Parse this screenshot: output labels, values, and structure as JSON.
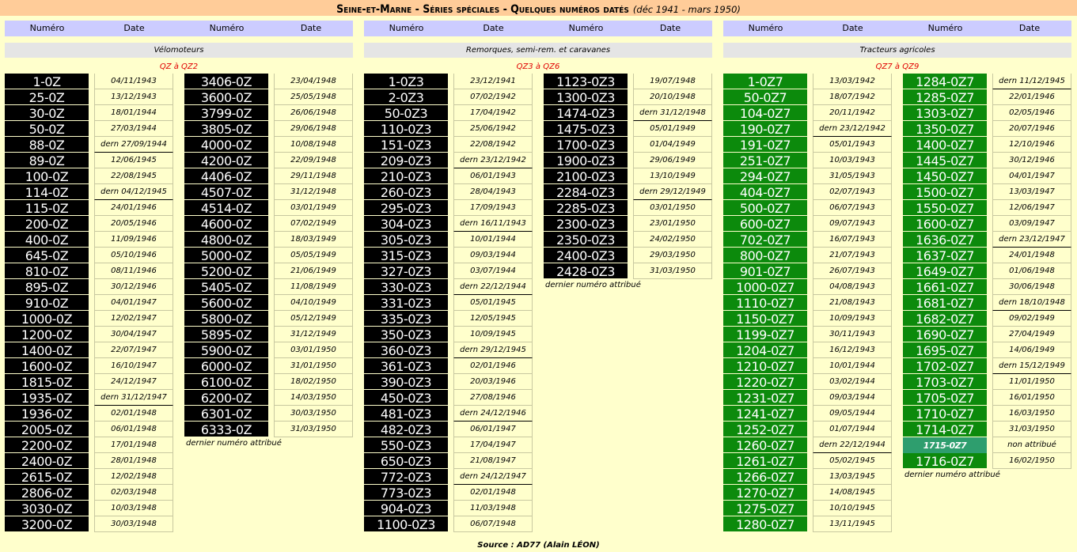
{
  "title": {
    "main": "Seine-et-Marne - Séries spéciales - Quelques numéros datés",
    "sub": "(déc 1941 - mars 1950)"
  },
  "headers": {
    "numero": "Numéro",
    "date": "Date"
  },
  "sections": [
    {
      "category": "Vélomoteurs",
      "range": "QZ à QZ2",
      "last_note": "dernier numéro attribué",
      "color": "#000000",
      "columns": [
        [
          [
            "1-0Z",
            "04/11/1943"
          ],
          [
            "25-0Z",
            "13/12/1943"
          ],
          [
            "30-0Z",
            "18/01/1944"
          ],
          [
            "50-0Z",
            "27/03/1944"
          ],
          [
            "88-0Z",
            "dern 27/09/1944"
          ],
          [
            "89-0Z",
            "12/06/1945"
          ],
          [
            "100-0Z",
            "22/08/1945"
          ],
          [
            "114-0Z",
            "dern 04/12/1945"
          ],
          [
            "115-0Z",
            "24/01/1946"
          ],
          [
            "200-0Z",
            "20/05/1946"
          ],
          [
            "400-0Z",
            "11/09/1946"
          ],
          [
            "645-0Z",
            "05/10/1946"
          ],
          [
            "810-0Z",
            "08/11/1946"
          ],
          [
            "895-0Z",
            "30/12/1946"
          ],
          [
            "910-0Z",
            "04/01/1947"
          ],
          [
            "1000-0Z",
            "12/02/1947"
          ],
          [
            "1200-0Z",
            "30/04/1947"
          ],
          [
            "1400-0Z",
            "22/07/1947"
          ],
          [
            "1600-0Z",
            "16/10/1947"
          ],
          [
            "1815-0Z",
            "24/12/1947"
          ],
          [
            "1935-0Z",
            "dern 31/12/1947"
          ],
          [
            "1936-0Z",
            "02/01/1948"
          ],
          [
            "2005-0Z",
            "06/01/1948"
          ],
          [
            "2200-0Z",
            "17/01/1948"
          ],
          [
            "2400-0Z",
            "28/01/1948"
          ],
          [
            "2615-0Z",
            "12/02/1948"
          ],
          [
            "2806-0Z",
            "02/03/1948"
          ],
          [
            "3030-0Z",
            "10/03/1948"
          ],
          [
            "3200-0Z",
            "30/03/1948"
          ]
        ],
        [
          [
            "3406-0Z",
            "23/04/1948"
          ],
          [
            "3600-0Z",
            "25/05/1948"
          ],
          [
            "3799-0Z",
            "26/06/1948"
          ],
          [
            "3805-0Z",
            "29/06/1948"
          ],
          [
            "4000-0Z",
            "10/08/1948"
          ],
          [
            "4200-0Z",
            "22/09/1948"
          ],
          [
            "4406-0Z",
            "29/11/1948"
          ],
          [
            "4507-0Z",
            "31/12/1948"
          ],
          [
            "4514-0Z",
            "03/01/1949"
          ],
          [
            "4600-0Z",
            "07/02/1949"
          ],
          [
            "4800-0Z",
            "18/03/1949"
          ],
          [
            "5000-0Z",
            "05/05/1949"
          ],
          [
            "5200-0Z",
            "21/06/1949"
          ],
          [
            "5405-0Z",
            "11/08/1949"
          ],
          [
            "5600-0Z",
            "04/10/1949"
          ],
          [
            "5800-0Z",
            "05/12/1949"
          ],
          [
            "5895-0Z",
            "31/12/1949"
          ],
          [
            "5900-0Z",
            "03/01/1950"
          ],
          [
            "6000-0Z",
            "31/01/1950"
          ],
          [
            "6100-0Z",
            "18/02/1950"
          ],
          [
            "6200-0Z",
            "14/03/1950"
          ],
          [
            "6301-0Z",
            "30/03/1950"
          ],
          [
            "6333-0Z",
            "31/03/1950"
          ]
        ]
      ]
    },
    {
      "category": "Remorques, semi-rem. et caravanes",
      "range": "QZ3 à QZ6",
      "last_note": "dernier numéro attribué",
      "color": "#000000",
      "columns": [
        [
          [
            "1-0Z3",
            "23/12/1941"
          ],
          [
            "2-0Z3",
            "07/02/1942"
          ],
          [
            "50-0Z3",
            "17/04/1942"
          ],
          [
            "110-0Z3",
            "25/06/1942"
          ],
          [
            "151-0Z3",
            "22/08/1942"
          ],
          [
            "209-0Z3",
            "dern 23/12/1942"
          ],
          [
            "210-0Z3",
            "06/01/1943"
          ],
          [
            "260-0Z3",
            "28/04/1943"
          ],
          [
            "295-0Z3",
            "17/09/1943"
          ],
          [
            "304-0Z3",
            "dern 16/11/1943"
          ],
          [
            "305-0Z3",
            "10/01/1944"
          ],
          [
            "315-0Z3",
            "09/03/1944"
          ],
          [
            "327-0Z3",
            "03/07/1944"
          ],
          [
            "330-0Z3",
            "dern 22/12/1944"
          ],
          [
            "331-0Z3",
            "05/01/1945"
          ],
          [
            "335-0Z3",
            "12/05/1945"
          ],
          [
            "350-0Z3",
            "10/09/1945"
          ],
          [
            "360-0Z3",
            "dern 29/12/1945"
          ],
          [
            "361-0Z3",
            "02/01/1946"
          ],
          [
            "390-0Z3",
            "20/03/1946"
          ],
          [
            "450-0Z3",
            "27/08/1946"
          ],
          [
            "481-0Z3",
            "dern 24/12/1946"
          ],
          [
            "482-0Z3",
            "06/01/1947"
          ],
          [
            "550-0Z3",
            "17/04/1947"
          ],
          [
            "650-0Z3",
            "21/08/1947"
          ],
          [
            "772-0Z3",
            "dern 24/12/1947"
          ],
          [
            "773-0Z3",
            "02/01/1948"
          ],
          [
            "904-0Z3",
            "11/03/1948"
          ],
          [
            "1100-0Z3",
            "06/07/1948"
          ]
        ],
        [
          [
            "1123-0Z3",
            "19/07/1948"
          ],
          [
            "1300-0Z3",
            "20/10/1948"
          ],
          [
            "1474-0Z3",
            "dern 31/12/1948"
          ],
          [
            "1475-0Z3",
            "05/01/1949"
          ],
          [
            "1700-0Z3",
            "01/04/1949"
          ],
          [
            "1900-0Z3",
            "29/06/1949"
          ],
          [
            "2100-0Z3",
            "13/10/1949"
          ],
          [
            "2284-0Z3",
            "dern 29/12/1949"
          ],
          [
            "2285-0Z3",
            "03/01/1950"
          ],
          [
            "2300-0Z3",
            "23/01/1950"
          ],
          [
            "2350-0Z3",
            "24/02/1950"
          ],
          [
            "2400-0Z3",
            "29/03/1950"
          ],
          [
            "2428-0Z3",
            "31/03/1950"
          ]
        ]
      ]
    },
    {
      "category": "Tracteurs agricoles",
      "range": "QZ7 à QZ9",
      "last_note": "dernier numéro attribué",
      "color": "#0c8a0c",
      "columns": [
        [
          [
            "1-0Z7",
            "13/03/1942"
          ],
          [
            "50-0Z7",
            "18/07/1942"
          ],
          [
            "104-0Z7",
            "20/11/1942"
          ],
          [
            "190-0Z7",
            "dern 23/12/1942"
          ],
          [
            "191-0Z7",
            "05/01/1943"
          ],
          [
            "251-0Z7",
            "10/03/1943"
          ],
          [
            "294-0Z7",
            "31/05/1943"
          ],
          [
            "404-0Z7",
            "02/07/1943"
          ],
          [
            "500-0Z7",
            "06/07/1943"
          ],
          [
            "600-0Z7",
            "09/07/1943"
          ],
          [
            "702-0Z7",
            "16/07/1943"
          ],
          [
            "800-0Z7",
            "21/07/1943"
          ],
          [
            "901-0Z7",
            "26/07/1943"
          ],
          [
            "1000-0Z7",
            "04/08/1943"
          ],
          [
            "1110-0Z7",
            "21/08/1943"
          ],
          [
            "1150-0Z7",
            "10/09/1943"
          ],
          [
            "1199-0Z7",
            "30/11/1943"
          ],
          [
            "1204-0Z7",
            "16/12/1943"
          ],
          [
            "1210-0Z7",
            "10/01/1944"
          ],
          [
            "1220-0Z7",
            "03/02/1944"
          ],
          [
            "1231-0Z7",
            "09/03/1944"
          ],
          [
            "1241-0Z7",
            "09/05/1944"
          ],
          [
            "1252-0Z7",
            "01/07/1944"
          ],
          [
            "1260-0Z7",
            "dern 22/12/1944"
          ],
          [
            "1261-0Z7",
            "05/02/1945"
          ],
          [
            "1266-0Z7",
            "13/03/1945"
          ],
          [
            "1270-0Z7",
            "14/08/1945"
          ],
          [
            "1275-0Z7",
            "10/10/1945"
          ],
          [
            "1280-0Z7",
            "13/11/1945"
          ]
        ],
        [
          [
            "1284-0Z7",
            "dern 11/12/1945"
          ],
          [
            "1285-0Z7",
            "22/01/1946"
          ],
          [
            "1303-0Z7",
            "02/05/1946"
          ],
          [
            "1350-0Z7",
            "20/07/1946"
          ],
          [
            "1400-0Z7",
            "12/10/1946"
          ],
          [
            "1445-0Z7",
            "30/12/1946"
          ],
          [
            "1450-0Z7",
            "04/01/1947"
          ],
          [
            "1500-0Z7",
            "13/03/1947"
          ],
          [
            "1550-0Z7",
            "12/06/1947"
          ],
          [
            "1600-0Z7",
            "03/09/1947"
          ],
          [
            "1636-0Z7",
            "dern 23/12/1947"
          ],
          [
            "1637-0Z7",
            "24/01/1948"
          ],
          [
            "1649-0Z7",
            "01/06/1948"
          ],
          [
            "1661-0Z7",
            "30/06/1948"
          ],
          [
            "1681-0Z7",
            "dern 18/10/1948"
          ],
          [
            "1682-0Z7",
            "09/02/1949"
          ],
          [
            "1690-0Z7",
            "27/04/1949"
          ],
          [
            "1695-0Z7",
            "14/06/1949"
          ],
          [
            "1702-0Z7",
            "dern 15/12/1949"
          ],
          [
            "1703-0Z7",
            "11/01/1950"
          ],
          [
            "1705-0Z7",
            "16/01/1950"
          ],
          [
            "1710-0Z7",
            "16/03/1950"
          ],
          [
            "1714-0Z7",
            "31/03/1950"
          ],
          [
            "1715-0Z7",
            "non attribué"
          ],
          [
            "1716-0Z7",
            "16/02/1950"
          ]
        ]
      ]
    }
  ],
  "source": "Source : AD77 (Alain LÉON)"
}
